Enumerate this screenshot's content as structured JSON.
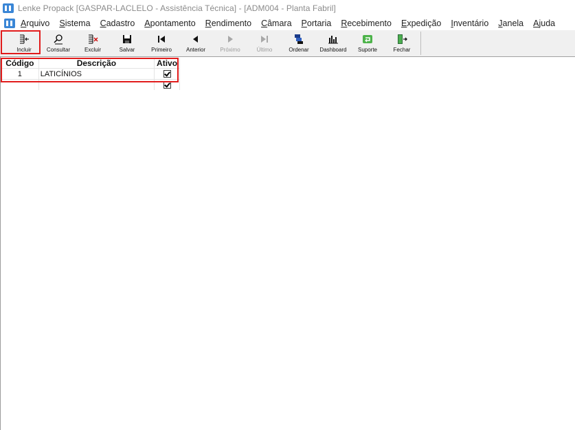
{
  "window": {
    "title": "Lenke Propack [GASPAR-LACLELO - Assistência Técnica] - [ADM004 - Planta Fabril]"
  },
  "menu": {
    "items": [
      {
        "first": "A",
        "rest": "rquivo"
      },
      {
        "first": "S",
        "rest": "istema"
      },
      {
        "first": "C",
        "rest": "adastro"
      },
      {
        "first": "A",
        "rest": "pontamento"
      },
      {
        "first": "R",
        "rest": "endimento"
      },
      {
        "first": "C",
        "rest": "âmara"
      },
      {
        "first": "P",
        "rest": "ortaria"
      },
      {
        "first": "R",
        "rest": "ecebimento"
      },
      {
        "first": "E",
        "rest": "xpedição"
      },
      {
        "first": "I",
        "rest": "nventário"
      },
      {
        "first": "J",
        "rest": "anela"
      },
      {
        "first": "A",
        "rest": "juda"
      }
    ]
  },
  "toolbar": {
    "incluir": "Incluir",
    "consultar": "Consultar",
    "excluir": "Excluir",
    "salvar": "Salvar",
    "primeiro": "Primeiro",
    "anterior": "Anterior",
    "proximo": "Próximo",
    "ultimo": "Último",
    "ordenar": "Ordenar",
    "dashboard": "Dashboard",
    "suporte": "Suporte",
    "fechar": "Fechar"
  },
  "grid": {
    "headers": {
      "codigo": "Código",
      "descricao": "Descrição",
      "ativo": "Ativo"
    },
    "rows": [
      {
        "codigo": "1",
        "descricao": "LATICÍNIOS",
        "ativo": true
      },
      {
        "codigo": "",
        "descricao": "",
        "ativo": true
      }
    ]
  },
  "colors": {
    "highlight": "#e11b1b",
    "accent": "#3a86d6"
  },
  "icons": [
    "app-icon",
    "incluir-icon",
    "consultar-icon",
    "excluir-icon",
    "salvar-icon",
    "primeiro-icon",
    "anterior-icon",
    "proximo-icon",
    "ultimo-icon",
    "ordenar-icon",
    "dashboard-icon",
    "suporte-icon",
    "fechar-icon",
    "checkbox-icon"
  ]
}
